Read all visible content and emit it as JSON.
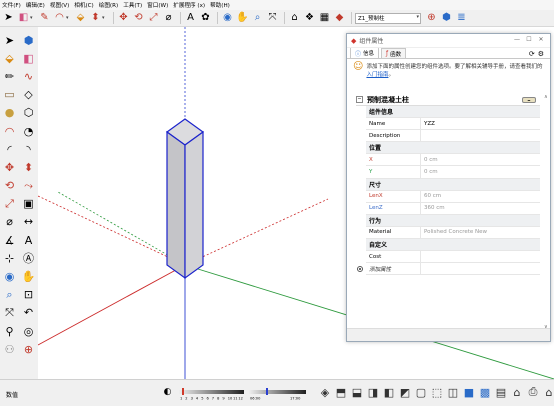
{
  "menu": [
    "文件(F)",
    "编辑(E)",
    "视图(V)",
    "相机(C)",
    "绘图(R)",
    "工具(T)",
    "窗口(W)",
    "扩展程序 (x)",
    "帮助(H)"
  ],
  "toolbar": {
    "left_icons": [
      "select-icon",
      "eraser-icon",
      "pencil-line-icon",
      "arc-icon",
      "paint-bucket-icon",
      "push-pull-icon",
      "move-icon",
      "rotate-icon",
      "scale-icon",
      "tape-measure-icon",
      "text-icon",
      "paint-icon",
      "orbit-icon",
      "pan-icon",
      "zoom-icon",
      "zoom-extents-icon",
      "warehouse-icon",
      "extension-warehouse-icon",
      "sandbox-icon",
      "ruby-icon"
    ],
    "scene_select": "Z1_预制柱",
    "right_icons": [
      "section-plane-icon",
      "component-icon",
      "layer-icon"
    ]
  },
  "left_tools": [
    "select-icon",
    "component-icon",
    "paint-bucket-icon",
    "eraser-icon",
    "pencil-icon",
    "freehand-icon",
    "rectangle-icon",
    "rotated-rectangle-icon",
    "circle-icon",
    "polygon-icon",
    "arc-icon",
    "pie-icon",
    "two-point-arc-icon",
    "three-point-arc-icon",
    "move-icon",
    "push-pull-icon",
    "rotate-icon",
    "follow-me-icon",
    "scale-icon",
    "offset-icon",
    "tape-measure-icon",
    "dimension-icon",
    "protractor-icon",
    "text-icon",
    "axes-icon",
    "3d-text-icon",
    "orbit-icon",
    "pan-icon",
    "zoom-icon",
    "zoom-window-icon",
    "zoom-extents-icon",
    "previous-view-icon",
    "position-camera-icon",
    "look-around-icon",
    "walk-icon",
    "section-plane-icon"
  ],
  "dialog": {
    "title": "组件属性",
    "tabs": [
      "信息",
      "函数"
    ],
    "hint_text": "添加下面的属性创建您的组件选项。要了解相关辅导手册，请查看我们的",
    "hint_link": "入门指南",
    "hint_end": "。",
    "component_name": "预制混凝土柱",
    "rows": [
      {
        "type": "section",
        "key": "组件信息"
      },
      {
        "type": "row",
        "key": "Name",
        "value": "YZZ",
        "kcolor": "",
        "gray": false
      },
      {
        "type": "row",
        "key": "Description",
        "value": "",
        "kcolor": "",
        "gray": false
      },
      {
        "type": "section",
        "key": "位置"
      },
      {
        "type": "row",
        "key": "X",
        "value": "0 cm",
        "kcolor": "red",
        "gray": true
      },
      {
        "type": "row",
        "key": "Y",
        "value": "0 cm",
        "kcolor": "green",
        "gray": true
      },
      {
        "type": "section",
        "key": "尺寸"
      },
      {
        "type": "row",
        "key": "LenX",
        "value": "60 cm",
        "kcolor": "red",
        "gray": true
      },
      {
        "type": "row",
        "key": "LenZ",
        "value": "360 cm",
        "kcolor": "blue",
        "gray": true
      },
      {
        "type": "section",
        "key": "行为"
      },
      {
        "type": "row",
        "key": "Material",
        "value": "Polished Concrete New",
        "kcolor": "",
        "gray": true
      },
      {
        "type": "section",
        "key": "自定义"
      },
      {
        "type": "row",
        "key": "Cost",
        "value": "",
        "kcolor": "",
        "gray": false
      },
      {
        "type": "add",
        "key": "添加属性"
      }
    ]
  },
  "status": {
    "label": "数值",
    "time_labels": [
      "1",
      "2",
      "3",
      "4",
      "5",
      "6",
      "7",
      "8",
      "9",
      "10",
      "11",
      "12",
      "06:00",
      "17:00"
    ],
    "view_icons": [
      "iso-view-icon",
      "top-view-icon",
      "front-view-icon",
      "right-view-icon",
      "back-view-icon",
      "left-view-icon",
      "xray-icon",
      "wireframe-icon",
      "hidden-line-icon",
      "shaded-icon",
      "textured-icon",
      "monochrome-icon",
      "home-icon",
      "print-icon",
      "house-icon",
      "warehouse-icon"
    ]
  },
  "colors": {
    "axis_red": "#cc2a2a",
    "axis_green": "#2e9a3e",
    "axis_blue": "#2a3fd1",
    "box_edge": "#1a22cc",
    "box_front": "#c4c4c8",
    "box_side": "#d2d2d6"
  }
}
